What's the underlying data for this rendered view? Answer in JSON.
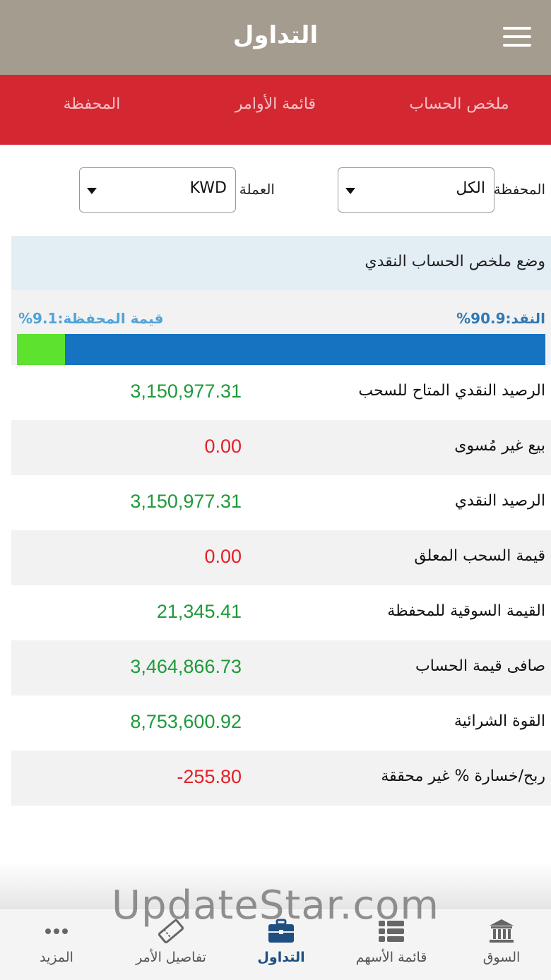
{
  "header": {
    "title": "التداول"
  },
  "tabs": [
    {
      "label": "المحفظة",
      "active": false
    },
    {
      "label": "قائمة الأوامر",
      "active": false
    },
    {
      "label": "ملخص الحساب",
      "active": true
    }
  ],
  "filters": {
    "portfolio_label": "المحفظة",
    "portfolio_value": "الكل",
    "currency_label": "العملة",
    "currency_value": "KWD"
  },
  "section": {
    "title": "وضع ملخص الحساب النقدي"
  },
  "ratio": {
    "cash_label": "النقد:90.9%",
    "portfolio_label": "قيمة المحفظة:9.1%",
    "cash_percent": 90.9,
    "portfolio_percent": 9.1,
    "cash_color": "#1573c1",
    "portfolio_color": "#5de22d"
  },
  "rows": [
    {
      "label": "الرصيد النقدي المتاح للسحب",
      "value": "3,150,977.31",
      "sign": "pos"
    },
    {
      "label": "بيع غير مُسوى",
      "value": "0.00",
      "sign": "neg"
    },
    {
      "label": "الرصيد النقدي",
      "value": "3,150,977.31",
      "sign": "pos"
    },
    {
      "label": "قيمة السحب المعلق",
      "value": "0.00",
      "sign": "neg"
    },
    {
      "label": "القيمة السوقية للمحفظة",
      "value": "21,345.41",
      "sign": "pos"
    },
    {
      "label": "صافى قيمة الحساب",
      "value": "3,464,866.73",
      "sign": "pos"
    },
    {
      "label": "القوة الشرائية",
      "value": "8,753,600.92",
      "sign": "pos"
    },
    {
      "label": "ربح/خسارة % غير محققة",
      "value": "-255.80",
      "sign": "neg"
    }
  ],
  "nav": [
    {
      "label": "المزيد",
      "icon": "more-icon",
      "active": false
    },
    {
      "label": "تفاصيل الأمر",
      "icon": "ticket-icon",
      "active": false
    },
    {
      "label": "التداول",
      "icon": "briefcase-icon",
      "active": true
    },
    {
      "label": "قائمة الأسهم",
      "icon": "list-icon",
      "active": false
    },
    {
      "label": "السوق",
      "icon": "bank-icon",
      "active": false
    }
  ],
  "watermark": "UpdateStar.com",
  "colors": {
    "header_bg": "#a49c8f",
    "tab_bg": "#d32832",
    "tab_indicator": "#4cb7e7",
    "positive": "#1f9a3a",
    "negative": "#e32027",
    "nav_active": "#1f4f80"
  }
}
